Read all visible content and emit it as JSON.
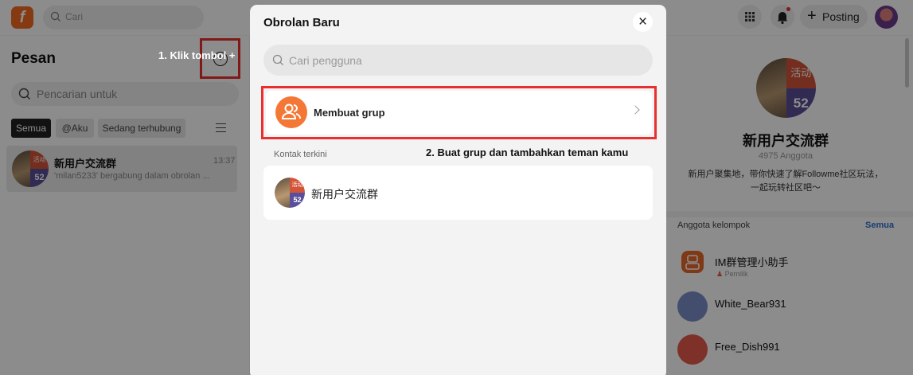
{
  "topbar": {
    "logo_text": "f",
    "search_placeholder": "Cari",
    "post_label": "Posting",
    "icons": [
      "apps-grid-icon",
      "bell-icon",
      "plus-icon"
    ]
  },
  "sidebar": {
    "title": "Pesan",
    "search_placeholder": "Pencarian untuk",
    "step1_annotation": "1. Klik tombol +",
    "filters": [
      "Semua",
      "@Aku",
      "Sedang terhubung"
    ],
    "conversation": {
      "name": "新用户交流群",
      "time": "13:37",
      "message": "'milan5233' bergabung dalam obrolan ...",
      "avatar_badge_top": "活动",
      "avatar_badge_bottom": "52"
    }
  },
  "modal": {
    "title": "Obrolan Baru",
    "search_placeholder": "Cari pengguna",
    "create_group_label": "Membuat grup",
    "recent_label": "Kontak terkini",
    "step2_annotation": "2. Buat grup dan tambahkan teman kamu",
    "recent_contacts": [
      {
        "name": "新用户交流群",
        "badge_top": "活动",
        "badge_bottom": "52"
      }
    ]
  },
  "group_panel": {
    "name": "新用户交流群",
    "member_count": "4975 Anggota",
    "description_line1": "新用户聚集地，带你快速了解Followme社区玩法，",
    "description_line2": "一起玩转社区吧～",
    "badge_top": "活动",
    "badge_bottom": "52",
    "members_label": "Anggota kelompok",
    "see_all": "Semua",
    "members": [
      {
        "name": "IM群管理小助手",
        "role": "Pemilik",
        "color": "#e8682a"
      },
      {
        "name": "White_Bear931",
        "role": "",
        "color": "#7a8fc9"
      },
      {
        "name": "Free_Dish991",
        "role": "",
        "color": "#e35a4b"
      }
    ]
  },
  "colors": {
    "accent": "#f26b21",
    "highlight_border": "#e8302e",
    "link": "#2f6fd1"
  }
}
